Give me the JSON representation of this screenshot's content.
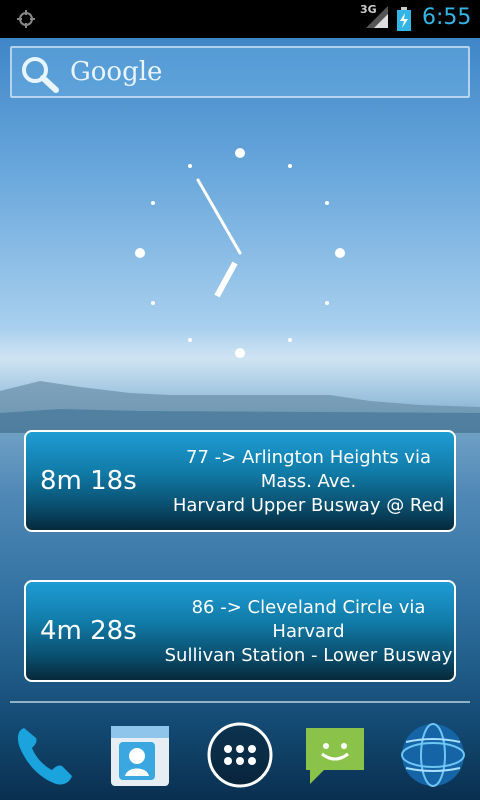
{
  "status": {
    "network": "3G",
    "time": "6:55",
    "icons": [
      "gps-icon",
      "signal-icon",
      "battery-charging-icon"
    ]
  },
  "search": {
    "label": "Google",
    "icon": "search-icon"
  },
  "widget": {
    "clock_icon": "analog-clock-icon"
  },
  "transit": [
    {
      "eta": "8m 18s",
      "route_line1": "77 -> Arlington Heights via",
      "route_line2": "Mass. Ave.",
      "stop": "Harvard Upper Busway @ Red"
    },
    {
      "eta": "4m 28s",
      "route_line1": "86 -> Cleveland Circle via",
      "route_line2": "Harvard",
      "stop": "Sullivan Station - Lower Busway"
    }
  ],
  "dock": {
    "icons": [
      "phone-icon",
      "contacts-icon",
      "app-drawer-icon",
      "messaging-icon",
      "browser-icon"
    ]
  },
  "colors": {
    "accent": "#33b5e5",
    "card_border": "#ffffff"
  }
}
